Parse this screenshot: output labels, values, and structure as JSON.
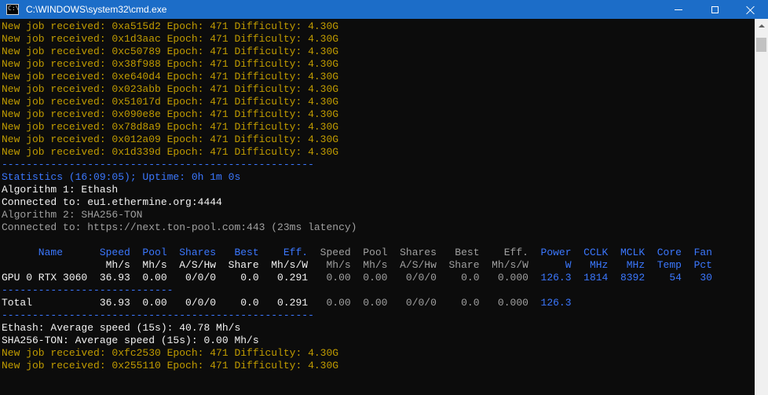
{
  "window": {
    "title": "C:\\WINDOWS\\system32\\cmd.exe",
    "icon_label": "C:\\"
  },
  "colors": {
    "titlebar": "#1c6dc8",
    "background": "#0c0c0c",
    "yellow": "#c19c00",
    "blue": "#3b78ff",
    "white": "#f2f2f2"
  },
  "console": {
    "lines": [
      {
        "text": "New job received: 0xa515d2 Epoch: 471 Difficulty: 4.30G",
        "color": "yellow"
      },
      {
        "text": "New job received: 0x1d3aac Epoch: 471 Difficulty: 4.30G",
        "color": "yellow"
      },
      {
        "text": "New job received: 0xc50789 Epoch: 471 Difficulty: 4.30G",
        "color": "yellow"
      },
      {
        "text": "New job received: 0x38f988 Epoch: 471 Difficulty: 4.30G",
        "color": "yellow"
      },
      {
        "text": "New job received: 0xe640d4 Epoch: 471 Difficulty: 4.30G",
        "color": "yellow"
      },
      {
        "text": "New job received: 0x023abb Epoch: 471 Difficulty: 4.30G",
        "color": "yellow"
      },
      {
        "text": "New job received: 0x51017d Epoch: 471 Difficulty: 4.30G",
        "color": "yellow"
      },
      {
        "text": "New job received: 0x090e8e Epoch: 471 Difficulty: 4.30G",
        "color": "yellow"
      },
      {
        "text": "New job received: 0x78d8a9 Epoch: 471 Difficulty: 4.30G",
        "color": "yellow"
      },
      {
        "text": "New job received: 0x012a09 Epoch: 471 Difficulty: 4.30G",
        "color": "yellow"
      },
      {
        "text": "New job received: 0x1d339d Epoch: 471 Difficulty: 4.30G",
        "color": "yellow"
      },
      {
        "text": "---------------------------------------------------",
        "color": "blue"
      },
      {
        "text": "Statistics (16:09:05); Uptime: 0h 1m 0s",
        "color": "blue"
      },
      {
        "text": "Algorithm 1: Ethash",
        "color": "white"
      },
      {
        "text": "Connected to: eu1.ethermine.org:4444",
        "color": "white"
      },
      {
        "text": "Algorithm 2: SHA256-TON",
        "color": "gray"
      },
      {
        "text": "Connected to: https://next.ton-pool.com:443 (23ms latency)",
        "color": "gray"
      },
      {
        "text": "",
        "color": "white"
      },
      {
        "segments": [
          {
            "text": "      Name      Speed  Pool  Shares   Best    Eff.  ",
            "color": "blue"
          },
          {
            "text": "Speed  Pool  Shares   Best    Eff.  ",
            "color": "gray"
          },
          {
            "text": "Power  CCLK  MCLK  Core  Fan",
            "color": "blue"
          }
        ]
      },
      {
        "segments": [
          {
            "text": "                 Mh/s  Mh/s  A/S/Hw  Share  Mh/s/W  ",
            "color": "white"
          },
          {
            "text": " Mh/s  Mh/s  A/S/Hw  Share  Mh/s/W  ",
            "color": "gray"
          },
          {
            "text": "    W   MHz   MHz  Temp  Pct",
            "color": "blue"
          }
        ]
      },
      {
        "segments": [
          {
            "text": "GPU 0 RTX 3060  36.93  0.00   0/0/0    0.0   0.291  ",
            "color": "white"
          },
          {
            "text": " 0.00  0.00   0/0/0    0.0   0.000  ",
            "color": "gray"
          },
          {
            "text": "126.3  1814  8392    54   30",
            "color": "blue"
          }
        ]
      },
      {
        "text": "----------------------------",
        "color": "blue"
      },
      {
        "segments": [
          {
            "text": "Total           36.93  0.00   0/0/0    0.0   0.291  ",
            "color": "white"
          },
          {
            "text": " 0.00  0.00   0/0/0    0.0   0.000  ",
            "color": "gray"
          },
          {
            "text": "126.3",
            "color": "blue"
          }
        ]
      },
      {
        "text": "---------------------------------------------------",
        "color": "blue"
      },
      {
        "text": "Ethash: Average speed (15s): 40.78 Mh/s",
        "color": "white"
      },
      {
        "text": "SHA256-TON: Average speed (15s): 0.00 Mh/s",
        "color": "white"
      },
      {
        "text": "New job received: 0xfc2530 Epoch: 471 Difficulty: 4.30G",
        "color": "yellow"
      },
      {
        "text": "New job received: 0x255110 Epoch: 471 Difficulty: 4.30G",
        "color": "yellow"
      }
    ]
  }
}
